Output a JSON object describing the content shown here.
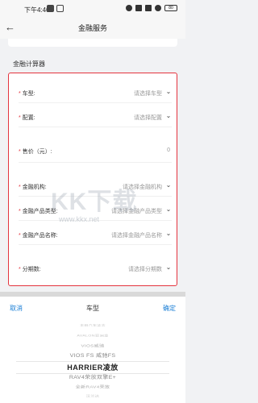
{
  "status_bar": {
    "time": "下午4:40",
    "battery": "80"
  },
  "nav": {
    "title": "金融服务"
  },
  "calculator": {
    "section_title": "金融计算器",
    "rows": [
      {
        "label": "车型:",
        "required": true,
        "value": "请选择车型",
        "has_chevron": true
      },
      {
        "label": "配置:",
        "required": true,
        "value": "请选择配置",
        "has_chevron": true
      },
      {
        "label": "售价（元）:",
        "required": true,
        "value": "0",
        "has_chevron": false
      },
      {
        "label": "金融机构:",
        "required": true,
        "value": "请选择金融机构",
        "has_chevron": true
      },
      {
        "label": "金融产品类型:",
        "required": true,
        "value": "请选择金融产品类型",
        "has_chevron": true
      },
      {
        "label": "金融产品名称:",
        "required": true,
        "value": "请选择金融产品名称",
        "has_chevron": true
      },
      {
        "label": "分期数:",
        "required": true,
        "value": "请选择分期数",
        "has_chevron": true
      }
    ],
    "required_mark": "*"
  },
  "watermark": {
    "main": "KK下载",
    "url": "www.kkx.net"
  },
  "picker": {
    "cancel": "取消",
    "title": "车型",
    "confirm": "确定",
    "items": [
      "丰田汽车凌志",
      "AVALON亚洲龙",
      "VIOS威驰",
      "VIOS FS 威驰FS",
      "HARRIER凌放",
      "RAV4荣放双擎E+",
      "全新RAV4荣放",
      "汉兰达"
    ],
    "selected_index": 4
  },
  "colors": {
    "required": "#e4343e",
    "action": "#1b7fd6",
    "highlight_border": "#e4343e"
  }
}
